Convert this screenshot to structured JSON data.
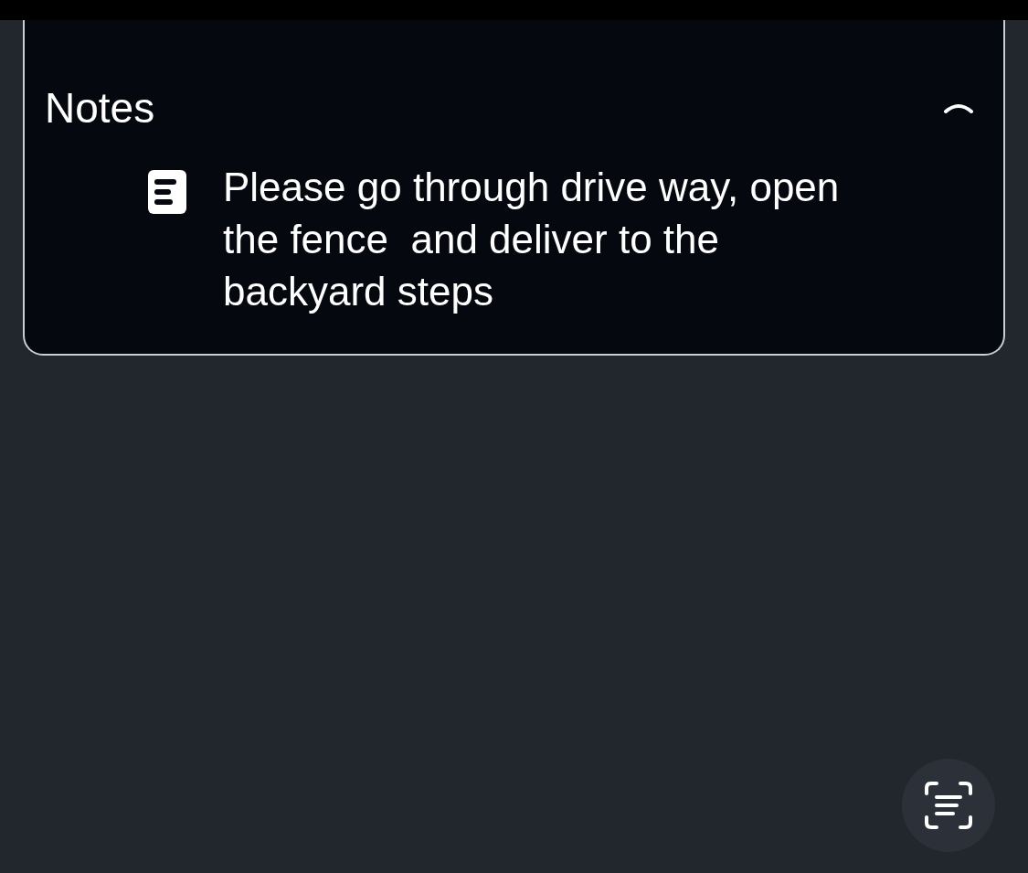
{
  "notes": {
    "title": "Notes",
    "expanded": true,
    "text": "Please go through drive way, open the fence  and deliver to the backyard steps"
  }
}
